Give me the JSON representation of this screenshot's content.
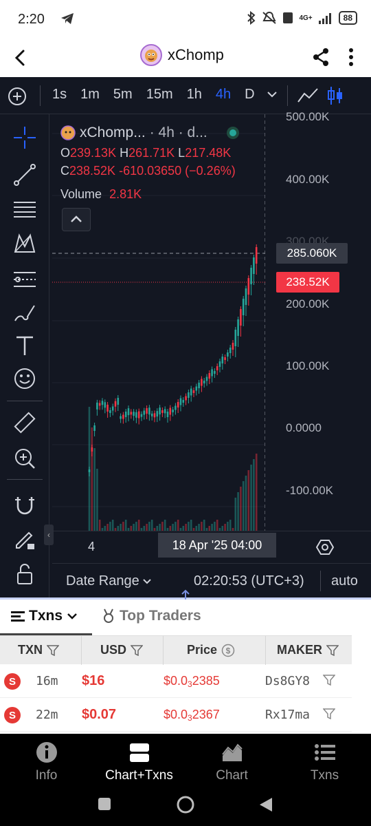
{
  "status_bar": {
    "time": "2:20",
    "network": "4G+",
    "battery": "88"
  },
  "header": {
    "title": "xChomp"
  },
  "toolbar": {
    "intervals": [
      "1s",
      "1m",
      "5m",
      "15m",
      "1h",
      "4h",
      "D"
    ],
    "active_interval": "4h"
  },
  "legend": {
    "symbol": "xChomp...",
    "suffix": "· 4h · d...",
    "o_label": "O",
    "o": "239.13K",
    "h_label": "H",
    "h": "261.71K",
    "l_label": "L",
    "l": "217.48K",
    "c_label": "C",
    "c": "238.52K",
    "change": "-610.03650 (−0.26%)",
    "volume_label": "Volume",
    "volume": "2.81K"
  },
  "price_axis": {
    "labels": [
      "500.00K",
      "400.00K",
      "300.00K",
      "200.00K",
      "100.00K",
      "0.0000",
      "-100.00K"
    ],
    "crosshair_price": "285.060K",
    "last_price": "238.52K"
  },
  "time_axis": {
    "labels": [
      "4"
    ],
    "crosshair_label": "18 Apr '25  04:00"
  },
  "bottom_bar": {
    "date_range": "Date Range",
    "time": "02:20:53 (UTC+3)",
    "scale": "auto"
  },
  "colors": {
    "up": "#26a69a",
    "down": "#f23645",
    "accent": "#2962ff",
    "background": "#131722"
  },
  "txns": {
    "tabs": [
      "Txns",
      "Top Traders"
    ],
    "columns": [
      "TXN",
      "USD",
      "Price",
      "MAKER"
    ],
    "rows": [
      {
        "type": "S",
        "age": "16m",
        "usd": "$16",
        "price_prefix": "$0.0",
        "price_sub": "3",
        "price_digits": "2385",
        "maker": "Ds8GY8"
      },
      {
        "type": "S",
        "age": "22m",
        "usd": "$0.07",
        "price_prefix": "$0.0",
        "price_sub": "3",
        "price_digits": "2367",
        "maker": "Rx17ma"
      }
    ]
  },
  "bottom_nav": {
    "items": [
      "Info",
      "Chart+Txns",
      "Chart",
      "Txns"
    ],
    "active": "Chart+Txns"
  }
}
